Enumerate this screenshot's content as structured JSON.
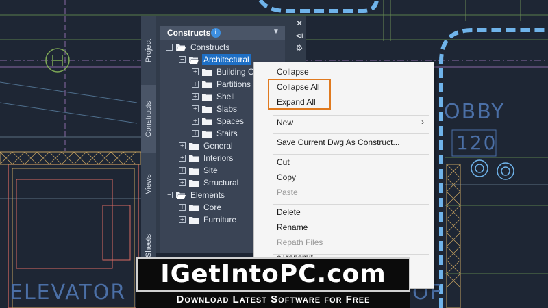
{
  "drawing": {
    "room_label": "OBBY",
    "room_number": "120",
    "left_label": "ELEVATOR",
    "right_label": "OF"
  },
  "palette": {
    "tabs": [
      {
        "label": "Project",
        "active": false
      },
      {
        "label": "Constructs",
        "active": true
      },
      {
        "label": "Views",
        "active": false
      },
      {
        "label": "Sheets",
        "active": false
      }
    ],
    "header": {
      "title": "Constructs",
      "info_icon": "i",
      "dropdown_icon": "▼"
    },
    "side_buttons": {
      "close": "✕",
      "pin": "⧏",
      "settings": "⚙"
    },
    "tree": [
      {
        "label": "Constructs",
        "level": 0,
        "toggle": "−",
        "open": true,
        "selected": false
      },
      {
        "label": "Architectural",
        "level": 1,
        "toggle": "−",
        "open": true,
        "selected": true
      },
      {
        "label": "Building C",
        "level": 2,
        "toggle": "+",
        "open": false,
        "selected": false
      },
      {
        "label": "Partitions",
        "level": 2,
        "toggle": "+",
        "open": false,
        "selected": false
      },
      {
        "label": "Shell",
        "level": 2,
        "toggle": "+",
        "open": false,
        "selected": false
      },
      {
        "label": "Slabs",
        "level": 2,
        "toggle": "+",
        "open": false,
        "selected": false
      },
      {
        "label": "Spaces",
        "level": 2,
        "toggle": "+",
        "open": false,
        "selected": false
      },
      {
        "label": "Stairs",
        "level": 2,
        "toggle": "+",
        "open": false,
        "selected": false
      },
      {
        "label": "General",
        "level": 1,
        "toggle": "+",
        "open": false,
        "selected": false
      },
      {
        "label": "Interiors",
        "level": 1,
        "toggle": "+",
        "open": false,
        "selected": false
      },
      {
        "label": "Site",
        "level": 1,
        "toggle": "+",
        "open": false,
        "selected": false
      },
      {
        "label": "Structural",
        "level": 1,
        "toggle": "+",
        "open": false,
        "selected": false
      },
      {
        "label": "Elements",
        "level": 0,
        "toggle": "−",
        "open": true,
        "selected": false
      },
      {
        "label": "Core",
        "level": 1,
        "toggle": "+",
        "open": false,
        "selected": false
      },
      {
        "label": "Furniture",
        "level": 1,
        "toggle": "+",
        "open": false,
        "selected": false
      }
    ]
  },
  "context_menu": {
    "items": [
      {
        "label": "Collapse",
        "disabled": false
      },
      {
        "label": "Collapse All",
        "disabled": false
      },
      {
        "label": "Expand All",
        "disabled": false
      },
      {
        "label": "New",
        "disabled": false,
        "submenu": true
      },
      {
        "label": "Save Current Dwg As Construct...",
        "disabled": false
      },
      {
        "label": "Cut",
        "disabled": false
      },
      {
        "label": "Copy",
        "disabled": false
      },
      {
        "label": "Paste",
        "disabled": true
      },
      {
        "label": "Delete",
        "disabled": false
      },
      {
        "label": "Rename",
        "disabled": false
      },
      {
        "label": "Repath Files",
        "disabled": true
      },
      {
        "label": "eTransmit...",
        "disabled": false
      }
    ],
    "submenu_arrow": "›",
    "highlight_color": "#e07a1f"
  },
  "watermark": {
    "title": "IGetIntoPC.com",
    "subtitle": "Download Latest Software for Free"
  }
}
